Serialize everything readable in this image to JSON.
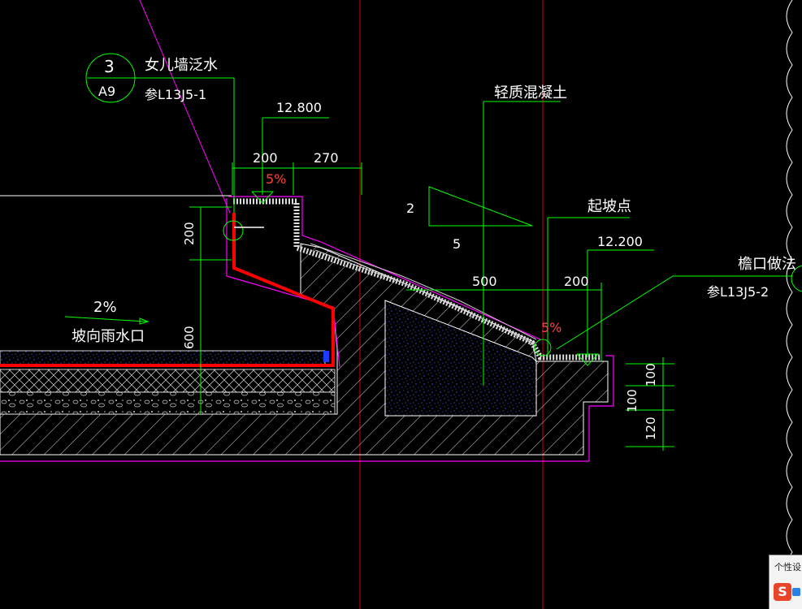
{
  "drawing": {
    "detail_circle": {
      "number": "3",
      "sheet": "A9"
    },
    "parapet_label": "女儿墙泛水",
    "parapet_ref": "参L13J5-1",
    "elevation_top": "12.800",
    "dim_200_top": "200",
    "dim_270": "270",
    "slope_5_left": "5%",
    "lightweight_concrete": "轻质混凝土",
    "slope_ratio_rise": "2",
    "slope_ratio_run": "5",
    "slope_start_point": "起坡点",
    "elevation_eave": "12.200",
    "dim_500": "500",
    "dim_200_right": "200",
    "slope_5_right": "5%",
    "eave_label": "檐口做法",
    "eave_ref": "参L13J5-2",
    "dim_200_vertical": "200",
    "roof_slope": "2%",
    "roof_slope_note": "坡向雨水口",
    "dim_600": "600",
    "dim_100_a": "100",
    "dim_100_b": "100",
    "dim_120": "120"
  },
  "ime_popup": {
    "label": "个性设",
    "logo": "S",
    "logo_color": "#e8442a",
    "accent_color": "#2a7fe8"
  },
  "colors": {
    "background": "#000000",
    "green": "#00ff00",
    "magenta": "#ff00ff",
    "red": "#ff0000",
    "white_text": "#ffffff",
    "blue_fill": "#1a3cff",
    "grid_red": "#b00000"
  }
}
